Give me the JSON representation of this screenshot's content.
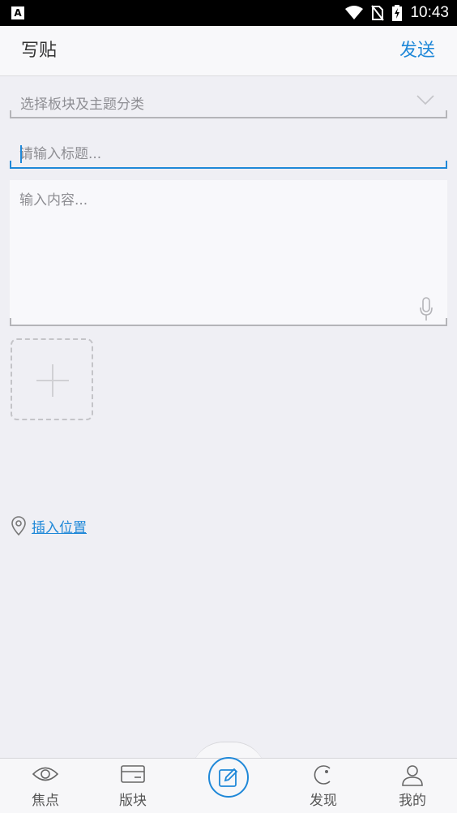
{
  "status_bar": {
    "app_badge": "A",
    "time": "10:43",
    "icons": [
      "wifi-icon",
      "no-sim-icon",
      "battery-charging-icon"
    ]
  },
  "header": {
    "title": "写贴",
    "send_label": "发送"
  },
  "form": {
    "category_select": {
      "placeholder": "选择板块及主题分类",
      "icon": "chevron-down-icon"
    },
    "title_input": {
      "placeholder": "请输入标题...",
      "value": ""
    },
    "content_input": {
      "placeholder": "输入内容...",
      "value": ""
    },
    "voice_icon": "microphone-icon",
    "add_image_icon": "plus-icon",
    "location": {
      "label": "插入位置",
      "icon": "location-pin-icon"
    }
  },
  "tabbar": {
    "tabs": [
      {
        "label": "焦点",
        "icon": "eye-icon"
      },
      {
        "label": "版块",
        "icon": "card-icon"
      },
      {
        "label": "",
        "icon": "compose-icon"
      },
      {
        "label": "发现",
        "icon": "discover-icon"
      },
      {
        "label": "我的",
        "icon": "user-icon"
      }
    ]
  },
  "colors": {
    "accent": "#1f88d8",
    "background": "#efeff4",
    "header_bg": "#f8f8fa",
    "placeholder": "#8e8e93"
  }
}
